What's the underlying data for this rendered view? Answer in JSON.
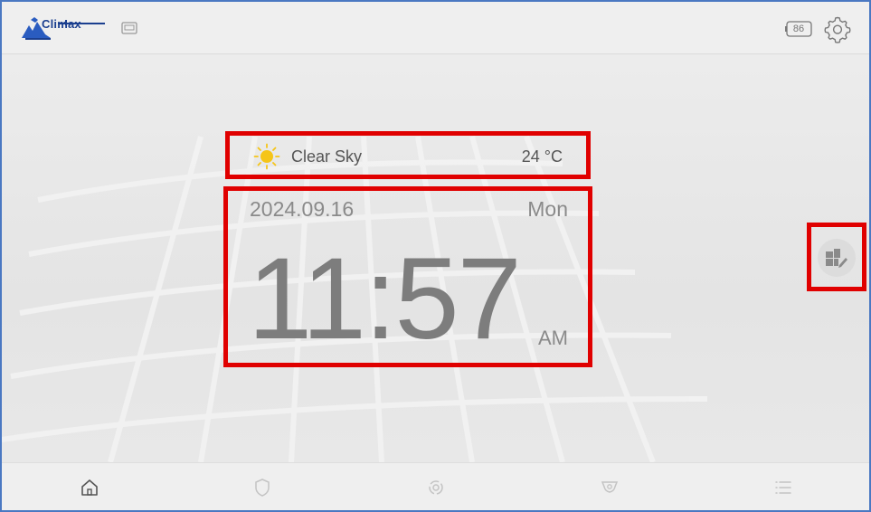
{
  "header": {
    "brand": "Climax",
    "battery_level": "86"
  },
  "weather": {
    "condition": "Clear Sky",
    "temperature": "24 °C",
    "icon": "sun-icon"
  },
  "clock": {
    "date": "2024.09.16",
    "day": "Mon",
    "time": "11:57",
    "period": "AM"
  },
  "nav": {
    "items": [
      {
        "icon": "home-icon",
        "active": true
      },
      {
        "icon": "shield-icon",
        "active": false
      },
      {
        "icon": "automation-icon",
        "active": false
      },
      {
        "icon": "camera-icon",
        "active": false
      },
      {
        "icon": "list-icon",
        "active": false
      }
    ]
  },
  "colors": {
    "accent_highlight": "#e00000",
    "brand_blue": "#1b3f8f",
    "sun_yellow": "#f5c518"
  }
}
